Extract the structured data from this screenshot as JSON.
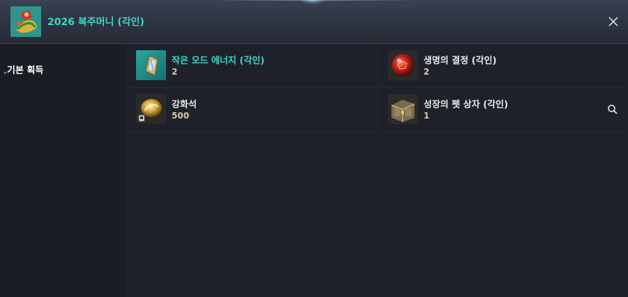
{
  "window": {
    "title": "2026 복주머니 (각인)",
    "accent_color": "#3fd6c8"
  },
  "sidebar": {
    "items": [
      {
        "label": "기본 획득",
        "selected": true
      }
    ]
  },
  "items": [
    {
      "name": "작은 오드 에너지 (각인)",
      "count": "2",
      "icon": "crystal-icon",
      "name_color": "#3fd6c8"
    },
    {
      "name": "생명의 결정 (각인)",
      "count": "2",
      "icon": "red-orb-icon",
      "name_color": "#e8e8e8"
    },
    {
      "name": "강화석",
      "count": "500",
      "icon": "enchant-stone-icon",
      "name_color": "#e8e8e8"
    },
    {
      "name": "성장의 펫 상자 (각인)",
      "count": "1",
      "icon": "treasure-chest-icon",
      "name_color": "#e8e8e8"
    }
  ],
  "icons": {
    "title": "lucky-bag-icon",
    "close": "close-icon",
    "search": "search-icon"
  }
}
